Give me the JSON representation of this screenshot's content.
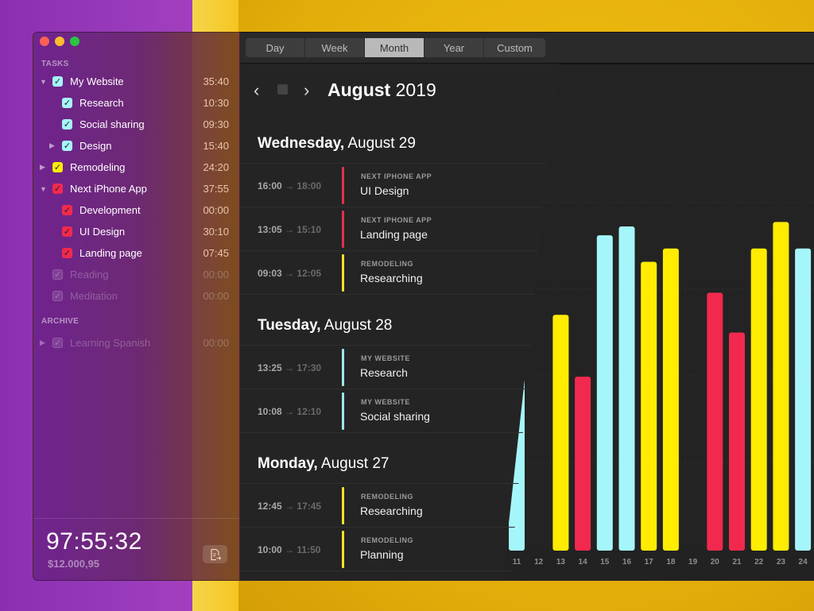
{
  "sidebar": {
    "tasks_label": "TASKS",
    "archive_label": "ARCHIVE",
    "tasks": [
      {
        "name": "My Website",
        "time": "35:40",
        "color": "#a5f6fa",
        "level": 0,
        "disclosure": "expanded",
        "dim": false
      },
      {
        "name": "Research",
        "time": "10:30",
        "color": "#a5f6fa",
        "level": 1,
        "disclosure": "none",
        "dim": false
      },
      {
        "name": "Social sharing",
        "time": "09:30",
        "color": "#a5f6fa",
        "level": 1,
        "disclosure": "none",
        "dim": false
      },
      {
        "name": "Design",
        "time": "15:40",
        "color": "#a5f6fa",
        "level": 1,
        "disclosure": "collapsed",
        "dim": false
      },
      {
        "name": "Remodeling",
        "time": "24:20",
        "color": "#ffec00",
        "level": 0,
        "disclosure": "collapsed",
        "dim": false
      },
      {
        "name": "Next iPhone App",
        "time": "37:55",
        "color": "#f2294e",
        "level": 0,
        "disclosure": "expanded",
        "dim": false
      },
      {
        "name": "Development",
        "time": "00:00",
        "color": "#f2294e",
        "level": 1,
        "disclosure": "none",
        "dim": false
      },
      {
        "name": "UI Design",
        "time": "30:10",
        "color": "#f2294e",
        "level": 1,
        "disclosure": "none",
        "dim": false
      },
      {
        "name": "Landing page",
        "time": "07:45",
        "color": "#f2294e",
        "level": 1,
        "disclosure": "none",
        "dim": false
      },
      {
        "name": "Reading",
        "time": "00:00",
        "color": "#ffffff",
        "level": 0,
        "disclosure": "none",
        "dim": true
      },
      {
        "name": "Meditation",
        "time": "00:00",
        "color": "#ffffff",
        "level": 0,
        "disclosure": "none",
        "dim": true
      }
    ],
    "archive": [
      {
        "name": "Learning Spanish",
        "time": "00:00",
        "color": "#ffffff",
        "level": 0,
        "disclosure": "collapsed",
        "dim": true
      }
    ],
    "total_time": "97:55:32",
    "total_money": "$12.000,95",
    "export_icon": "export-document-icon"
  },
  "toolbar": {
    "tabs": [
      "Day",
      "Week",
      "Month",
      "Year",
      "Custom"
    ],
    "active_tab": "Month"
  },
  "nav": {
    "prev_icon": "‹",
    "next_icon": "›",
    "month": "August",
    "year": "2019"
  },
  "days": [
    {
      "weekday": "Wednesday,",
      "date": "August 29",
      "entries": [
        {
          "start": "16:00",
          "end": "18:00",
          "project": "NEXT IPHONE APP",
          "task": "UI Design",
          "color": "#e0304f"
        },
        {
          "start": "13:05",
          "end": "15:10",
          "project": "NEXT IPHONE APP",
          "task": "Landing page",
          "color": "#e0304f"
        },
        {
          "start": "09:03",
          "end": "12:05",
          "project": "REMODELING",
          "task": "Researching",
          "color": "#f3e12a"
        }
      ]
    },
    {
      "weekday": "Tuesday,",
      "date": "August 28",
      "entries": [
        {
          "start": "13:25",
          "end": "17:30",
          "project": "MY WEBSITE",
          "task": "Research",
          "color": "#9ee6ea"
        },
        {
          "start": "10:08",
          "end": "12:10",
          "project": "MY WEBSITE",
          "task": "Social sharing",
          "color": "#9ee6ea"
        }
      ]
    },
    {
      "weekday": "Monday,",
      "date": "August 27",
      "entries": [
        {
          "start": "12:45",
          "end": "17:45",
          "project": "REMODELING",
          "task": "Researching",
          "color": "#f3e12a"
        },
        {
          "start": "10:00",
          "end": "11:50",
          "project": "REMODELING",
          "task": "Planning",
          "color": "#f3e12a"
        }
      ]
    }
  ],
  "arrow": "→",
  "chart_data": {
    "type": "bar",
    "title": "",
    "xlabel": "",
    "ylabel": "",
    "categories": [
      "11",
      "12",
      "13",
      "14",
      "15",
      "16",
      "17",
      "18",
      "19",
      "20",
      "21",
      "22",
      "23",
      "24"
    ],
    "values": [
      7.2,
      0,
      5.3,
      3.9,
      7.1,
      7.3,
      6.5,
      6.8,
      0,
      5.8,
      4.9,
      6.8,
      7.4,
      6.8
    ],
    "colors": [
      "#a5f6fa",
      "#a5f6fa",
      "#ffec00",
      "#f2294e",
      "#a5f6fa",
      "#a5f6fa",
      "#ffec00",
      "#ffec00",
      "#a5f6fa",
      "#f2294e",
      "#f2294e",
      "#ffec00",
      "#ffec00",
      "#a5f6fa"
    ],
    "series_colors": {
      "My Website": "#a5f6fa",
      "Remodeling": "#ffec00",
      "Next iPhone App": "#f2294e"
    },
    "ylim": [
      0,
      8
    ],
    "grid": true
  }
}
